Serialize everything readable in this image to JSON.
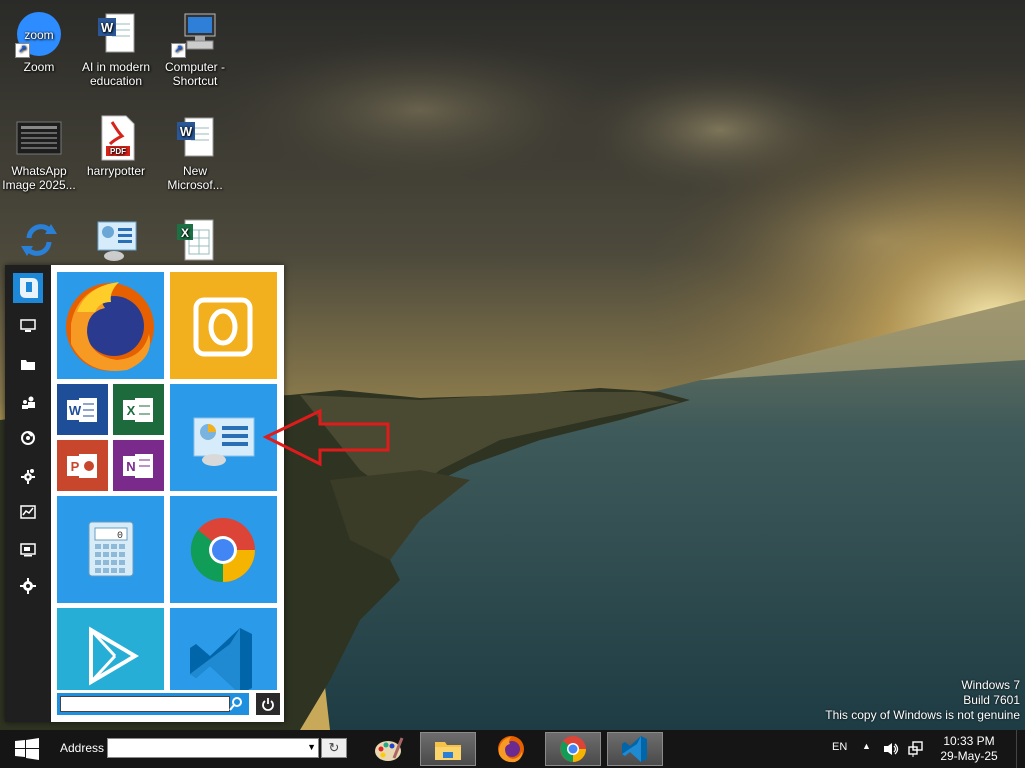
{
  "desktop": {
    "icons": [
      {
        "label": "Zoom",
        "icon": "zoom-icon"
      },
      {
        "label": "AI in modern education",
        "icon": "word-document-icon"
      },
      {
        "label": "Computer - Shortcut",
        "icon": "computer-icon"
      },
      {
        "label": "WhatsApp Image 2025...",
        "icon": "image-file-icon"
      },
      {
        "label": "harrypotter",
        "icon": "pdf-icon"
      },
      {
        "label": "New Microsof...",
        "icon": "word-document-icon"
      },
      {
        "label": "",
        "icon": "sync-icon"
      },
      {
        "label": "",
        "icon": "control-panel-icon"
      },
      {
        "label": "",
        "icon": "excel-document-icon"
      }
    ]
  },
  "start_menu": {
    "rail": [
      "start-logo-icon",
      "monitor-icon",
      "folder-icon",
      "users-icon",
      "network-icon",
      "settings-gear-icon",
      "performance-icon",
      "display-icon",
      "gear-icon"
    ],
    "tiles": [
      {
        "name": "firefox",
        "icon": "firefox-icon",
        "color": "#2b9ae8"
      },
      {
        "name": "outlook",
        "icon": "outlook-icon",
        "color": "#f2b01e"
      },
      {
        "name": "word",
        "icon": "word-icon",
        "color": "#1f4e99"
      },
      {
        "name": "excel",
        "icon": "excel-icon",
        "color": "#1d6b3d"
      },
      {
        "name": "powerpoint",
        "icon": "powerpoint-icon",
        "color": "#c8462b"
      },
      {
        "name": "onenote",
        "icon": "onenote-icon",
        "color": "#7a2a8a"
      },
      {
        "name": "control-panel",
        "icon": "control-panel-icon",
        "color": "#2b9ae8"
      },
      {
        "name": "calculator",
        "icon": "calculator-icon",
        "color": "#2b9ae8"
      },
      {
        "name": "chrome",
        "icon": "chrome-icon",
        "color": "#2b9ae8"
      },
      {
        "name": "play-store",
        "icon": "play-store-icon",
        "color": "#27aed6"
      },
      {
        "name": "vscode",
        "icon": "vscode-icon",
        "color": "#2b9ae8"
      }
    ],
    "search": {
      "value": "",
      "placeholder": ""
    }
  },
  "watermark": {
    "line1": "Windows 7",
    "line2": "Build 7601",
    "line3": "This copy of Windows is not genuine"
  },
  "taskbar": {
    "address_label": "Address",
    "address_value": "",
    "pinned": [
      "paint-icon",
      "file-explorer-icon",
      "firefox-icon",
      "chrome-icon",
      "vscode-icon"
    ],
    "tray": {
      "language": "EN",
      "time": "10:33 PM",
      "date": "29-May-25"
    }
  },
  "colors": {
    "tile_blue": "#2b9ae8",
    "taskbar": "#151515",
    "annotation_arrow": "#e01b1b"
  }
}
